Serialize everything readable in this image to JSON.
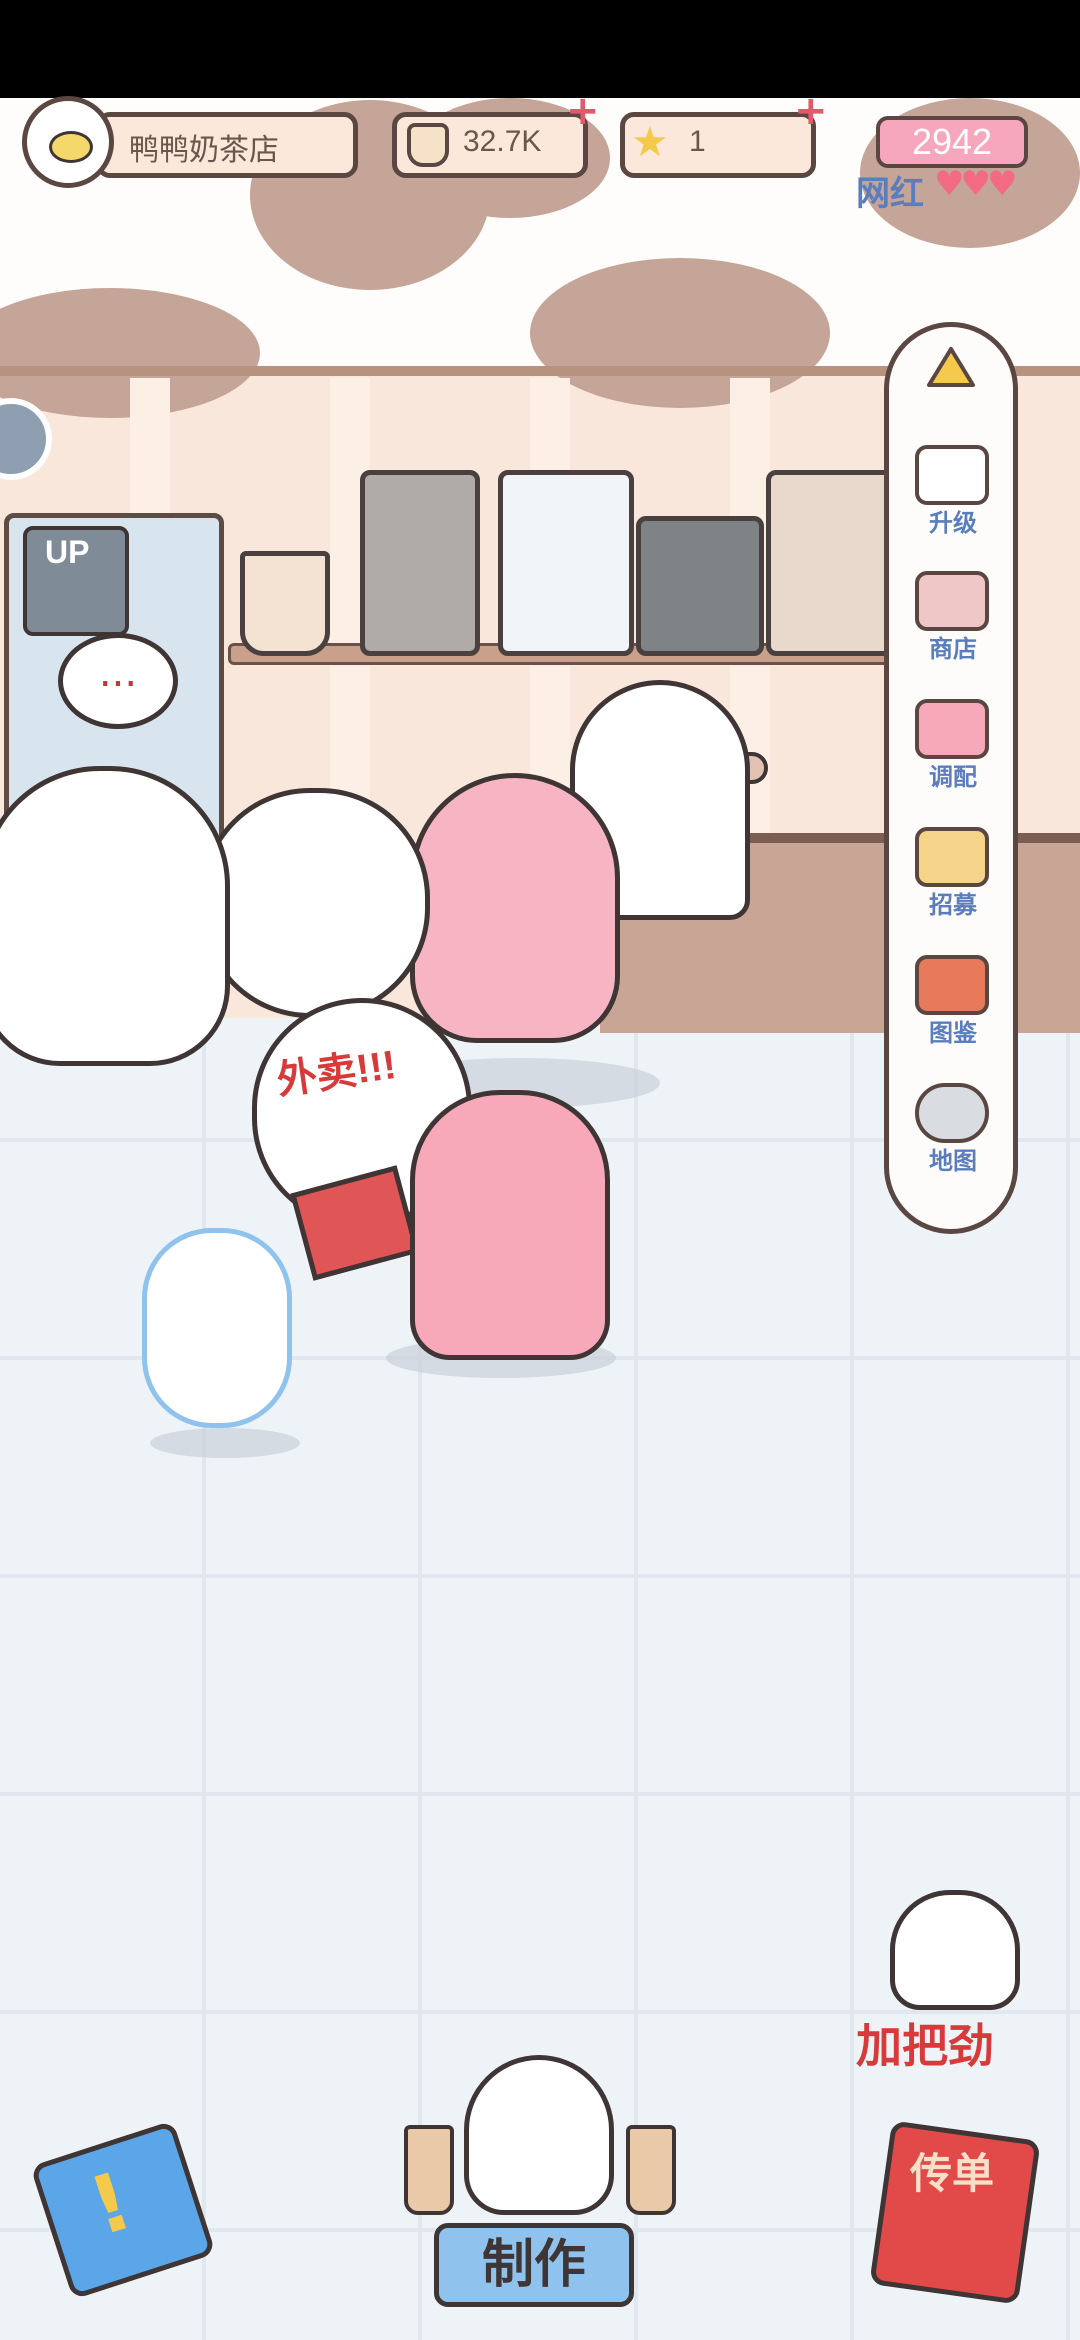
{
  "header": {
    "shop_name": "鸭鸭奶茶店",
    "currency_value": "32.7K",
    "star_value": "1",
    "fans_value": "2942",
    "fans_label": "网红",
    "fans_hearts": "♥♥♥"
  },
  "side_menu": {
    "items": [
      {
        "label": "升级",
        "icon": "ghost-icon"
      },
      {
        "label": "商店",
        "icon": "shop-icon"
      },
      {
        "label": "调配",
        "icon": "mix-icon"
      },
      {
        "label": "招募",
        "icon": "recruit-icon"
      },
      {
        "label": "图鉴",
        "icon": "catalog-icon"
      },
      {
        "label": "地图",
        "icon": "map-icon"
      }
    ]
  },
  "scene": {
    "delivery_text": "外卖!!!",
    "upgrade_badge": "UP",
    "progress": 0.25,
    "thought_bubble": "..."
  },
  "bottom": {
    "make_label": "制作",
    "cheer_label": "加把劲",
    "flyer_label": "传单"
  },
  "colors": {
    "accent_blue": "#8fc2ec",
    "accent_pink": "#f7a7bd",
    "progress_green": "#4fd43a",
    "wall": "#f9e7db"
  }
}
